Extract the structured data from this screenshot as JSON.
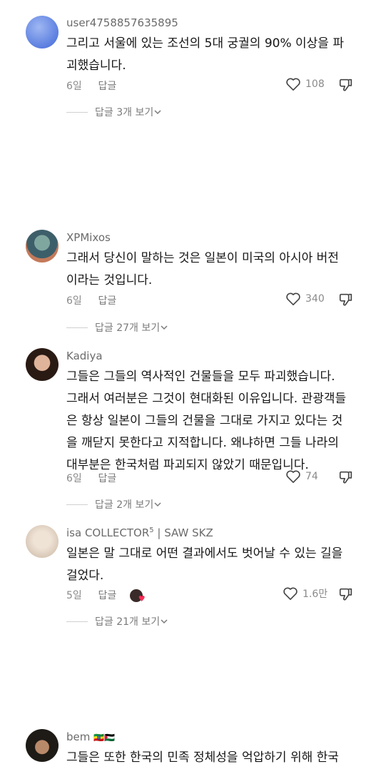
{
  "comments": [
    {
      "username": "user4758857635895",
      "text": "그리고 서울에 있는 조선의 5대 궁궐의 90% 이상을 파\n괴했습니다.",
      "age": "6일",
      "reply": "답글",
      "likes": "108",
      "thread": "답글 3개 보기",
      "avatar": "blue-gradient"
    },
    {
      "username": "XPMixos",
      "text": "그래서 당신이 말하는 것은 일본이 미국의 아시아 버전\n이라는 것입니다.",
      "age": "6일",
      "reply": "답글",
      "likes": "340",
      "thread": "답글 27개 보기",
      "avatar": "cartoon-character"
    },
    {
      "username": "Kadiya",
      "text": "그들은 그들의 역사적인 건물들을 모두 파괴했습니다.\n그래서 여러분은 그것이 현대화된 이유입니다. 관광객들\n은 항상 일본이 그들의 건물을 그대로 가지고 있다는 것\n을 깨닫지 못한다고 지적합니다. 왜냐하면 그들 나라의\n대부분은 한국처럼 파괴되지 않았기 때문입니다.",
      "age": "6일",
      "reply": "답글",
      "likes": "74",
      "thread": "답글 2개 보기",
      "avatar": "portrait"
    },
    {
      "username": "isa COLLECTOR",
      "username_sup": "5",
      "username_suffix": " | SAW SKZ",
      "text": "일본은 말 그대로 어떤 결과에서도 벗어날 수 있는 길을\n걸었다.",
      "age": "5일",
      "reply": "답글",
      "likes": "1.6만",
      "thread": "답글 21개 보기",
      "avatar": "blurred-portrait",
      "creator_liked": true
    },
    {
      "username": "bem",
      "username_flags": "🇪🇹🇵🇸",
      "text": "그들은 또한 한국의 민족 정체성을 억압하기 위해 한국",
      "avatar": "curly-hair"
    }
  ],
  "icons": {
    "like": "heart-outline-icon",
    "dislike": "thumbs-down-icon",
    "expand": "chevron-down-icon"
  },
  "colors": {
    "secondary_text": "#8a8a8a",
    "creator_heart": "#fe2c55"
  }
}
